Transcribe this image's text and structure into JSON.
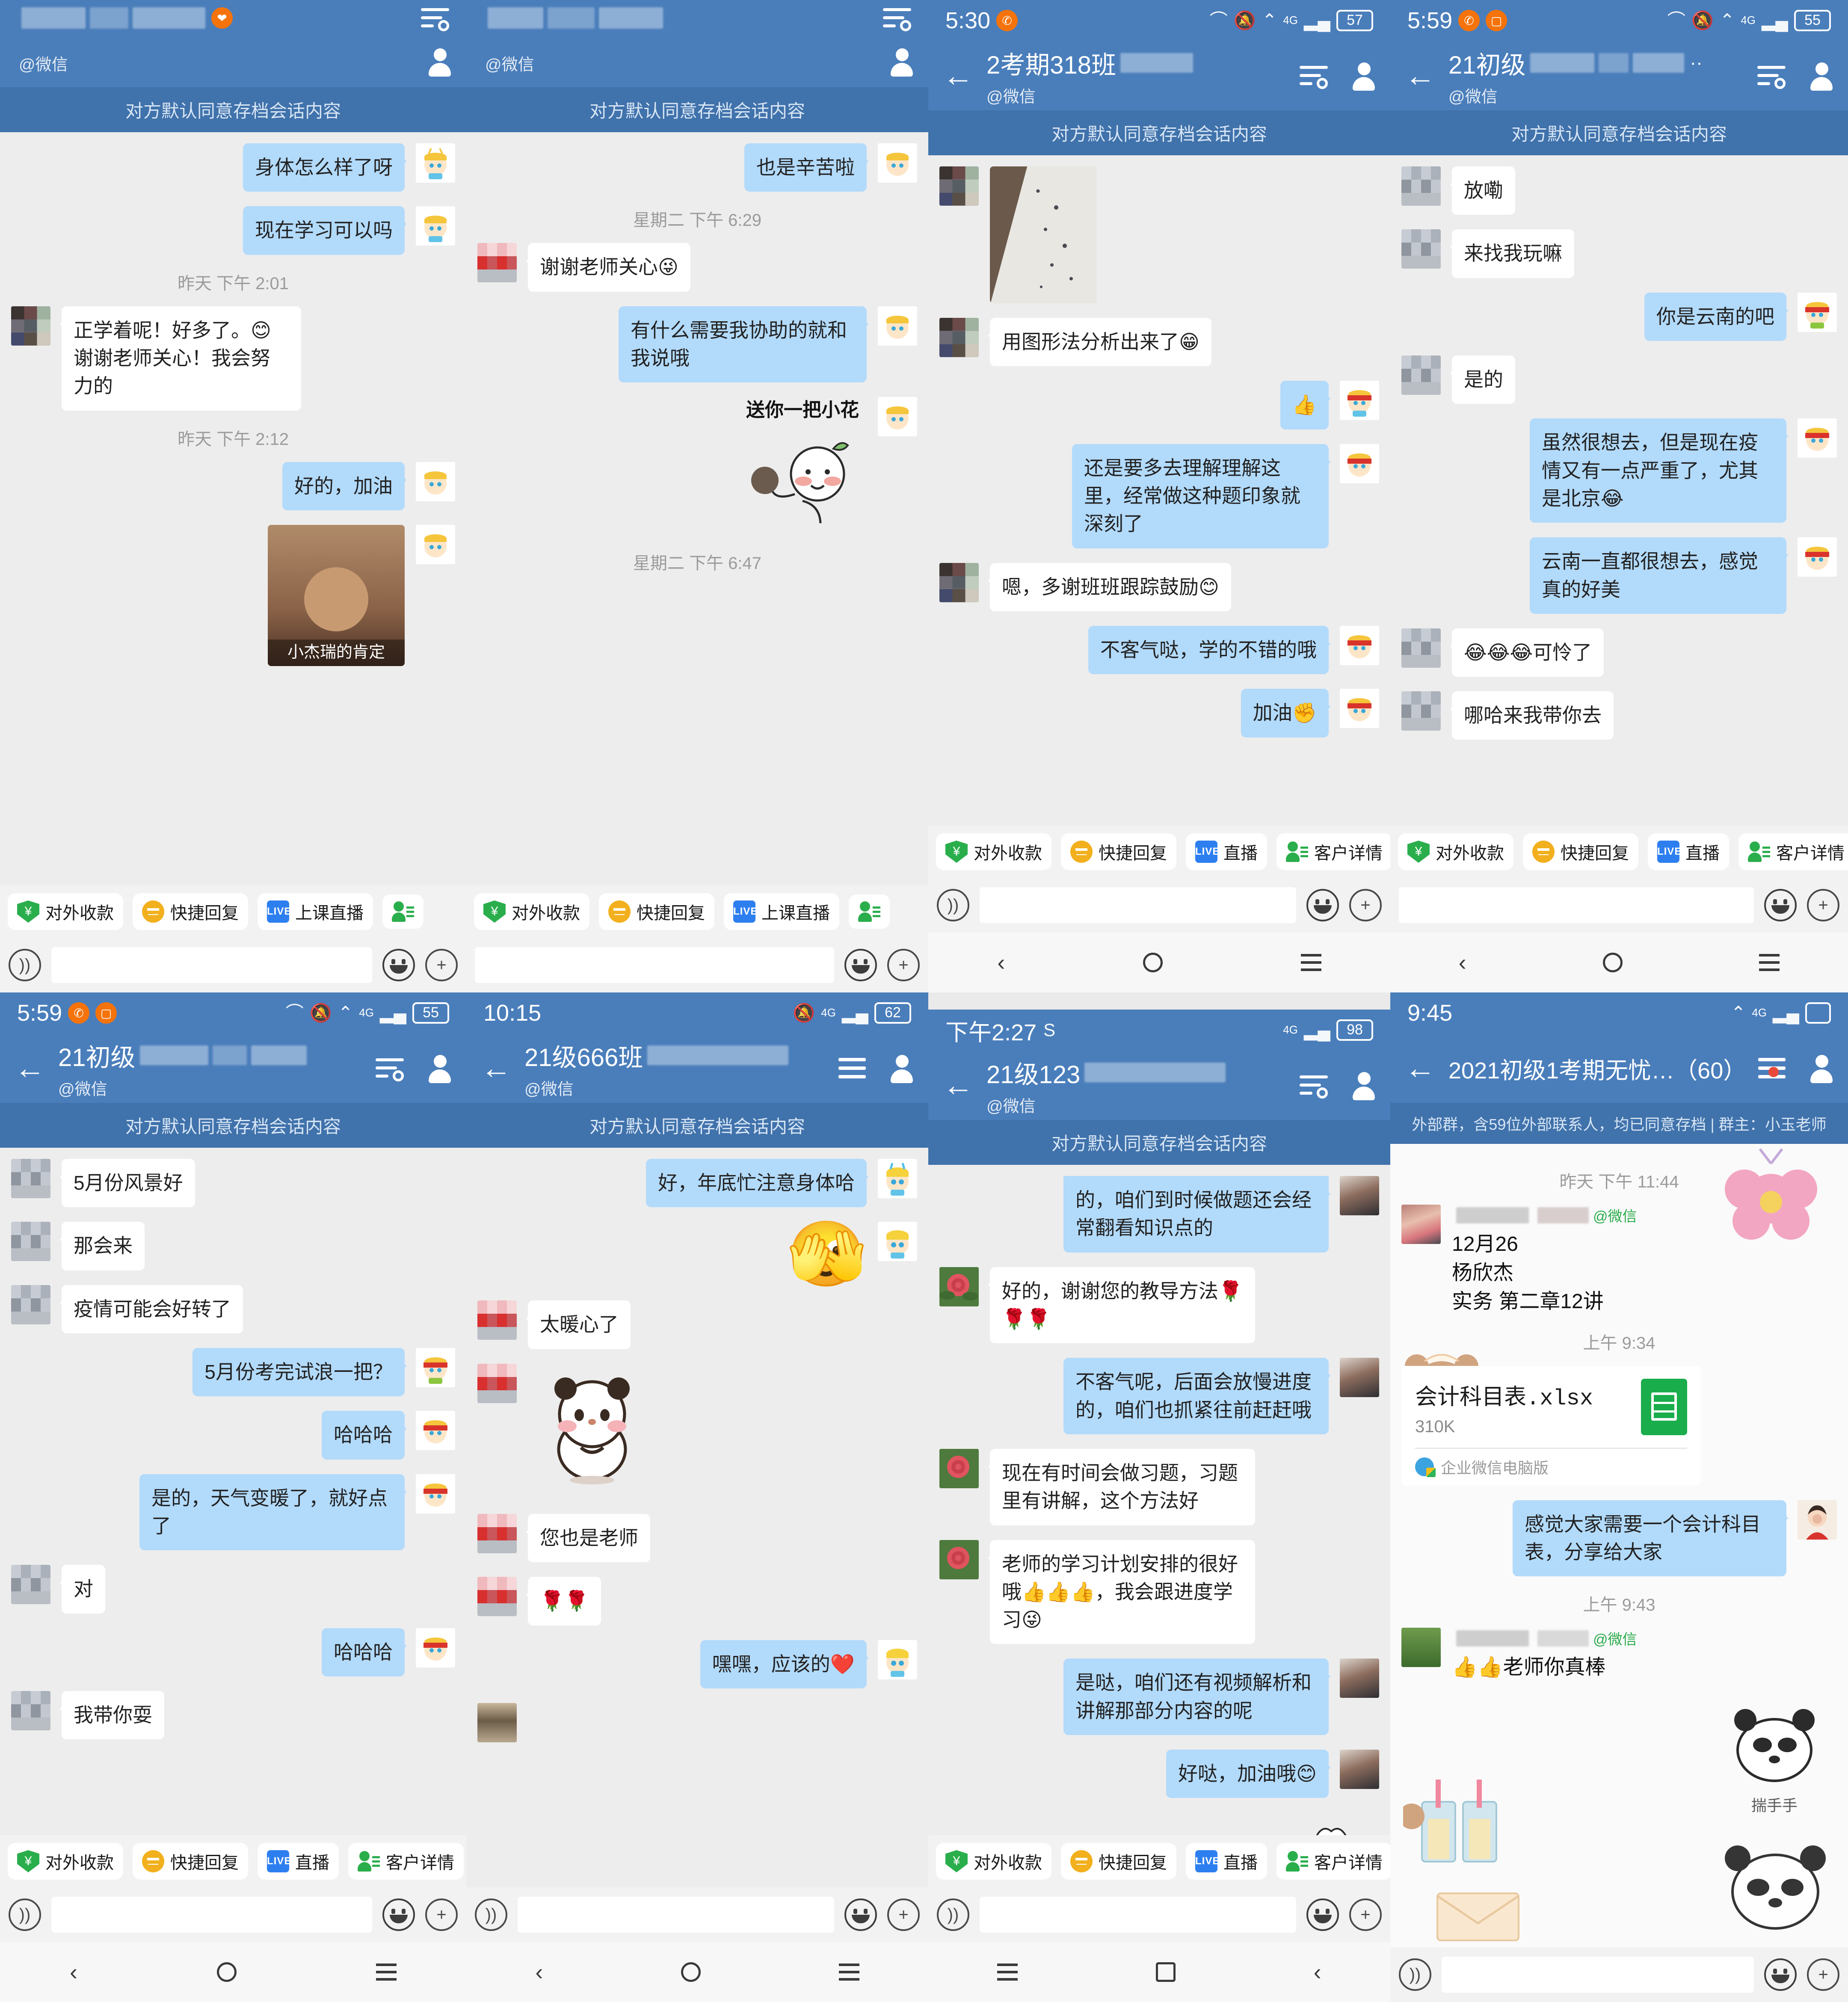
{
  "app": {
    "archive_banner": "对方默认同意存档会话内容",
    "wechat_sub": "@微信",
    "quick_actions": [
      "对外收款",
      "快捷回复",
      "上课直播",
      "客户详情",
      "直播"
    ],
    "more_ellipsis": "··"
  },
  "panels": [
    {
      "id": "panel-1",
      "status": {
        "time": "",
        "battery": ""
      },
      "title": "",
      "subtitle": "@微信",
      "banner": "对方默认同意存档会话内容",
      "messages": [
        {
          "side": "out",
          "type": "text",
          "text": "身体怎么样了呀"
        },
        {
          "side": "out",
          "type": "text",
          "text": "现在学习可以吗"
        },
        {
          "type": "time",
          "text": "昨天 下午 2:01"
        },
        {
          "side": "in",
          "type": "text",
          "text": "正学着呢！好多了。😊谢谢老师关心！我会努力的"
        },
        {
          "type": "time",
          "text": "昨天 下午 2:12"
        },
        {
          "side": "out",
          "type": "text",
          "text": "好的，加油"
        },
        {
          "side": "out",
          "type": "sticker",
          "text": "小杰瑞的肯定"
        }
      ],
      "quick_actions": [
        "对外收款",
        "快捷回复",
        "上课直播"
      ]
    },
    {
      "id": "panel-2",
      "status": {
        "time": "",
        "battery": ""
      },
      "title": "",
      "subtitle": "@微信",
      "banner": "对方默认同意存档会话内容",
      "messages": [
        {
          "side": "out",
          "type": "text",
          "text": "也是辛苦啦"
        },
        {
          "type": "time",
          "text": "星期二 下午 6:29"
        },
        {
          "side": "in",
          "type": "text",
          "text": "谢谢老师关心😜"
        },
        {
          "side": "out",
          "type": "text",
          "text": "有什么需要我协助的就和我说哦"
        },
        {
          "side": "out",
          "type": "sticker",
          "text": "送你一把小花"
        },
        {
          "type": "time",
          "text": "星期二 下午 6:47"
        }
      ],
      "quick_actions": [
        "对外收款",
        "快捷回复",
        "上课直播"
      ]
    },
    {
      "id": "panel-3",
      "status": {
        "time": "5:30",
        "battery": "57",
        "network": "4G"
      },
      "title": "2考期318班",
      "subtitle": "@微信",
      "banner": "对方默认同意存档会话内容",
      "messages": [
        {
          "side": "in",
          "type": "image",
          "text": ""
        },
        {
          "side": "in",
          "type": "text",
          "text": "用图形法分析出来了😁"
        },
        {
          "side": "out",
          "type": "text",
          "text": "👍"
        },
        {
          "side": "out",
          "type": "text",
          "text": "还是要多去理解理解这里，经常做这种题印象就深刻了"
        },
        {
          "side": "in",
          "type": "text",
          "text": "嗯，多谢班班跟踪鼓励😊"
        },
        {
          "side": "out",
          "type": "text",
          "text": "不客气哒，学的不错的哦"
        },
        {
          "side": "out",
          "type": "text",
          "text": "加油✊"
        }
      ],
      "quick_actions": [
        "对外收款",
        "快捷回复",
        "直播",
        "客户详情"
      ]
    },
    {
      "id": "panel-4",
      "status": {
        "time": "5:59",
        "battery": "55",
        "network": "4G"
      },
      "title": "21初级",
      "subtitle": "@微信",
      "banner": "对方默认同意存档会话内容",
      "messages": [
        {
          "side": "in",
          "type": "text",
          "text": "放嘞"
        },
        {
          "side": "in",
          "type": "text",
          "text": "来找我玩嘛"
        },
        {
          "side": "out",
          "type": "text",
          "text": "你是云南的吧"
        },
        {
          "side": "in",
          "type": "text",
          "text": "是的"
        },
        {
          "side": "out",
          "type": "text",
          "text": "虽然很想去，但是现在疫情又有一点严重了，尤其是北京😂"
        },
        {
          "side": "out",
          "type": "text",
          "text": "云南一直都很想去，感觉真的好美"
        },
        {
          "side": "in",
          "type": "text",
          "text": "😂😂😂可怜了"
        },
        {
          "side": "in",
          "type": "text",
          "text": "哪哈来我带你去"
        }
      ],
      "quick_actions": [
        "对外收款",
        "快捷回复",
        "直播",
        "客户详情"
      ]
    },
    {
      "id": "panel-5",
      "status": {
        "time": "5:59",
        "battery": "55",
        "network": "4G"
      },
      "title": "21初级",
      "subtitle": "@微信",
      "banner": "对方默认同意存档会话内容",
      "messages": [
        {
          "side": "in",
          "type": "text",
          "text": "5月份风景好"
        },
        {
          "side": "in",
          "type": "text",
          "text": "那会来"
        },
        {
          "side": "in",
          "type": "text",
          "text": "疫情可能会好转了"
        },
        {
          "side": "out",
          "type": "text",
          "text": "5月份考完试浪一把？"
        },
        {
          "side": "out",
          "type": "text",
          "text": "哈哈哈"
        },
        {
          "side": "out",
          "type": "text",
          "text": "是的，天气变暖了，就好点了"
        },
        {
          "side": "in",
          "type": "text",
          "text": "对"
        },
        {
          "side": "out",
          "type": "text",
          "text": "哈哈哈"
        },
        {
          "side": "in",
          "type": "text",
          "text": "我带你耍"
        }
      ],
      "quick_actions": [
        "对外收款",
        "快捷回复",
        "直播",
        "客户详情"
      ]
    },
    {
      "id": "panel-6",
      "status": {
        "time": "10:15",
        "battery": "62",
        "network": "4G"
      },
      "title": "21级666班",
      "subtitle": "@微信",
      "banner": "对方默认同意存档会话内容",
      "messages": [
        {
          "side": "out",
          "type": "text",
          "text": "好，年底忙注意身体哈"
        },
        {
          "side": "out",
          "type": "emoji",
          "text": "🫣"
        },
        {
          "side": "in",
          "type": "text",
          "text": "太暖心了"
        },
        {
          "side": "in",
          "type": "sticker",
          "text": "panda-sticker"
        },
        {
          "side": "in",
          "type": "text",
          "text": "您也是老师"
        },
        {
          "side": "in",
          "type": "text",
          "text": "🌹🌹"
        },
        {
          "side": "out",
          "type": "text",
          "text": "嘿嘿，应该的❤️"
        }
      ],
      "quick_actions": []
    },
    {
      "id": "panel-7",
      "status": {
        "time": "下午2:27",
        "battery": "98",
        "network": "4G"
      },
      "title": "21级123",
      "subtitle": "@微信",
      "banner": "对方默认同意存档会话内容",
      "messages": [
        {
          "side": "out",
          "type": "text",
          "text": "的，咱们到时候做题还会经常翻看知识点的"
        },
        {
          "side": "in",
          "type": "text",
          "text": "好的，谢谢您的教导方法🌹🌹🌹"
        },
        {
          "side": "out",
          "type": "text",
          "text": "不客气呢，后面会放慢进度的，咱们也抓紧往前赶赶哦"
        },
        {
          "side": "in",
          "type": "text",
          "text": "现在有时间会做习题，习题里有讲解，这个方法好"
        },
        {
          "side": "in",
          "type": "text",
          "text": "老师的学习计划安排的很好哦👍👍👍，我会跟进度学习😜"
        },
        {
          "side": "out",
          "type": "text",
          "text": "是哒，咱们还有视频解析和讲解那部分内容的呢"
        },
        {
          "side": "out",
          "type": "text",
          "text": "好哒，加油哦😊"
        },
        {
          "side": "out",
          "type": "sticker",
          "text": "hands-sticker"
        }
      ],
      "quick_actions": [
        "对外收款",
        "快捷回复",
        "直播",
        "客户详情"
      ]
    },
    {
      "id": "panel-8",
      "status": {
        "time": "9:45",
        "battery": "",
        "network": "4G"
      },
      "title": "2021初级1考期无忧…（60）",
      "banner": "外部群，含59位外部联系人，均已同意存档 | 群主：小玉老师",
      "messages": [
        {
          "type": "time",
          "text": "昨天 下午 11:44"
        },
        {
          "side": "in",
          "type": "named",
          "sender_tag": "@微信",
          "text": "12月26\n杨欣杰\n实务  第二章12讲"
        },
        {
          "type": "time",
          "text": "上午 9:34"
        },
        {
          "side": "in",
          "type": "file",
          "filename": "会计科目表.xlsx",
          "filesize": "310K",
          "source": "企业微信电脑版"
        },
        {
          "side": "out",
          "type": "text",
          "text": "感觉大家需要一个会计科目表，分享给大家"
        },
        {
          "type": "time",
          "text": "上午 9:43"
        },
        {
          "side": "in",
          "type": "named",
          "sender_tag": "@微信",
          "text": "👍👍老师你真棒"
        },
        {
          "side": "in",
          "type": "sticker",
          "text": "揣手手"
        }
      ],
      "quick_actions": []
    }
  ],
  "colors": {
    "nav_blue": "#4a7ebb",
    "banner_blue": "#4072ab",
    "bubble_out": "#b2dafb",
    "bubble_in": "#ffffff",
    "chat_bg": "#ededed",
    "green": "#2aae4c",
    "yellow": "#f2b01e",
    "live_blue": "#2d7ff0"
  }
}
